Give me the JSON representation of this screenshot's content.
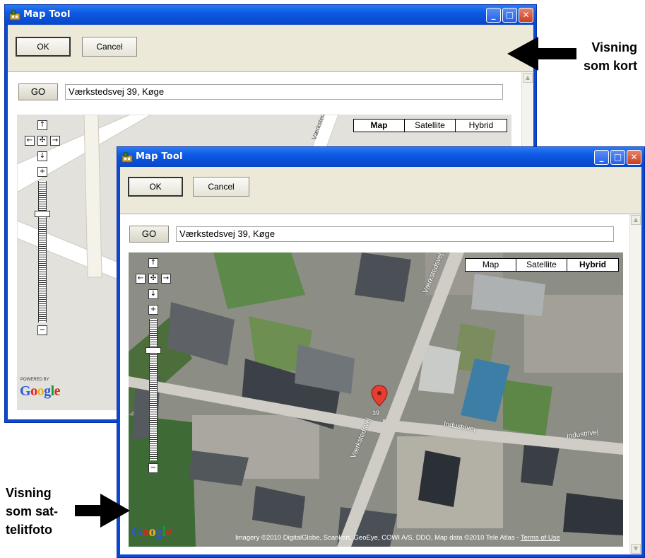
{
  "back_window": {
    "title": "Map Tool",
    "ok_label": "OK",
    "cancel_label": "Cancel",
    "go_label": "GO",
    "address_value": "Værkstedsvej 39, Køge",
    "map_types": [
      "Map",
      "Satellite",
      "Hybrid"
    ],
    "selected_map_type": "Map",
    "powered_by": "POWERED BY",
    "logo": "Google",
    "street_label": "Værkstedsvej"
  },
  "front_window": {
    "title": "Map Tool",
    "ok_label": "OK",
    "cancel_label": "Cancel",
    "go_label": "GO",
    "address_value": "Værkstedsvej 39, Køge",
    "map_types": [
      "Map",
      "Satellite",
      "Hybrid"
    ],
    "selected_map_type": "Hybrid",
    "logo": "Google",
    "attribution": "Imagery ©2010 DigitalGlobe, Scankort, GeoEye, COWI A/S, DDO, Map data ©2010 Tele Atlas - ",
    "terms_link": "Terms of Use",
    "street_labels": [
      "Værkstedsvej",
      "Industrivej",
      "Industrivej",
      "Værkstedsvej",
      "39"
    ]
  },
  "window_buttons": {
    "minimize": "_",
    "maximize": "□",
    "close": "✕"
  },
  "nav_glyphs": {
    "up": "↑",
    "down": "↓",
    "left": "←",
    "right": "→",
    "center": "✣",
    "zoom_in": "+",
    "zoom_out": "−"
  },
  "callouts": {
    "map_view": [
      "Visning",
      "som kort"
    ],
    "satellite_view": [
      "Visning",
      "som sat-",
      "telitfoto"
    ]
  },
  "colors": {
    "xp_titlebar": "#0a58e0",
    "window_face": "#ece9d8",
    "map_background": "#e5e3df",
    "map_road": "#ffffff",
    "marker": "#e53d2f"
  }
}
